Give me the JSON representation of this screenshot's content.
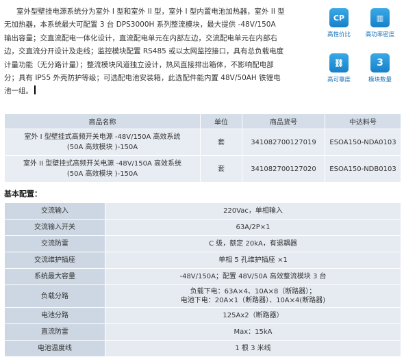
{
  "intro": {
    "text": "室外型壁挂电源系统分为室外 I 型和室外 II 型，室外 I 型内置电池加热器，室外 II 型无加热器，本系统最大可配置 3 台 DPS3000H 系列整流模块，最大提供 -48V/150A 输出容量；交直流配电一体化设计，直流配电单元在内部左边，交流配电单元在内部右边，交直流分开设计及走线；监控模块配置 RS485 或以太网监控接口，具有总负载电度计量功能（无分路计量）；整流模块风道独立设计，热风直接排出箱体，不影响配电部分；具有 IP55 外壳防护等级；可选配电池安装箱，此选配件能内置 48V/50AH 铁锂电池一组。"
  },
  "features": [
    {
      "icon": "cp-icon",
      "glyph": "CP",
      "label": "高性价比"
    },
    {
      "icon": "density-icon",
      "glyph": "▥",
      "label": "高功率密度"
    },
    {
      "icon": "link-icon",
      "glyph": "⛓",
      "label": "高可靠度"
    },
    {
      "icon": "module-count-icon",
      "glyph": "3",
      "label": "模块数量"
    }
  ],
  "product_table": {
    "headers": [
      "商品名称",
      "单位",
      "商品货号",
      "中达料号"
    ],
    "rows": [
      {
        "name_1": "室外 I 型壁挂式高频开关电源 -48V/150A 高效系统",
        "name_2": "(50A 高效模块 )-150A",
        "unit": "套",
        "sku": "341082700127019",
        "part": "ESOA150-NDA0103"
      },
      {
        "name_1": "室外 II 型壁挂式高频开关电源 -48V/150A 高效系统",
        "name_2": "(50A 高效模块 )-150A",
        "unit": "套",
        "sku": "341082700127020",
        "part": "ESOA150-NDB0103"
      }
    ]
  },
  "config_title": "基本配置：",
  "config": [
    {
      "k": "交流输入",
      "v1": "220Vac，单相输入",
      "v2": ""
    },
    {
      "k": "交流输入开关",
      "v1": "63A/2P×1",
      "v2": ""
    },
    {
      "k": "交流防雷",
      "v1": "C 级，额定 20kA，有退耦器",
      "v2": ""
    },
    {
      "k": "交流维护插座",
      "v1": "单相 5 孔维护插座 ×1",
      "v2": ""
    },
    {
      "k": "系统最大容量",
      "v1": "-48V/150A；配置 48V/50A 高效整流模块 3 台",
      "v2": ""
    },
    {
      "k": "负载分路",
      "v1": "负载下电：63A×4、10A×8（断路器）；",
      "v2": "电池下电：20A×1（断路器）、10A×4(断路器)"
    },
    {
      "k": "电池分路",
      "v1": "125Ax2（断路器）",
      "v2": ""
    },
    {
      "k": "直流防雷",
      "v1": "Max：15kA",
      "v2": ""
    },
    {
      "k": "电池温度线",
      "v1": "1 根 3 米线",
      "v2": ""
    }
  ]
}
